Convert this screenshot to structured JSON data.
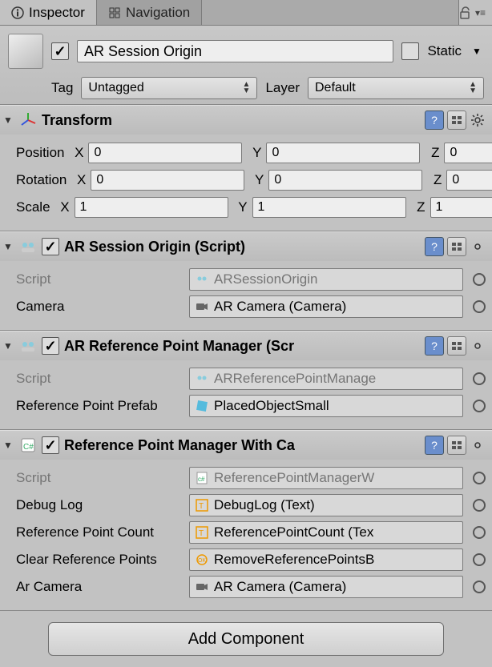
{
  "tabs": {
    "inspector": "Inspector",
    "navigation": "Navigation"
  },
  "header": {
    "name": "AR Session Origin",
    "static_label": "Static",
    "tag_label": "Tag",
    "tag_value": "Untagged",
    "layer_label": "Layer",
    "layer_value": "Default"
  },
  "transform": {
    "title": "Transform",
    "position_label": "Position",
    "rotation_label": "Rotation",
    "scale_label": "Scale",
    "x": "X",
    "y": "Y",
    "z": "Z",
    "pos": {
      "x": "0",
      "y": "0",
      "z": "0"
    },
    "rot": {
      "x": "0",
      "y": "0",
      "z": "0"
    },
    "scale": {
      "x": "1",
      "y": "1",
      "z": "1"
    }
  },
  "arso": {
    "title": "AR Session Origin (Script)",
    "script_label": "Script",
    "script_value": "ARSessionOrigin",
    "camera_label": "Camera",
    "camera_value": "AR Camera (Camera)"
  },
  "arpm": {
    "title": "AR Reference Point Manager (Scr",
    "script_label": "Script",
    "script_value": "ARReferencePointManage",
    "prefab_label": "Reference Point Prefab",
    "prefab_value": "PlacedObjectSmall"
  },
  "rpmc": {
    "title": "Reference Point Manager With Ca",
    "script_label": "Script",
    "script_value": "ReferencePointManagerW",
    "debug_label": "Debug Log",
    "debug_value": "DebugLog (Text)",
    "count_label": "Reference Point Count",
    "count_value": "ReferencePointCount (Tex",
    "clear_label": "Clear Reference Points",
    "clear_value": "RemoveReferencePointsB",
    "cam_label": "Ar Camera",
    "cam_value": "AR Camera (Camera)"
  },
  "add": "Add Component"
}
